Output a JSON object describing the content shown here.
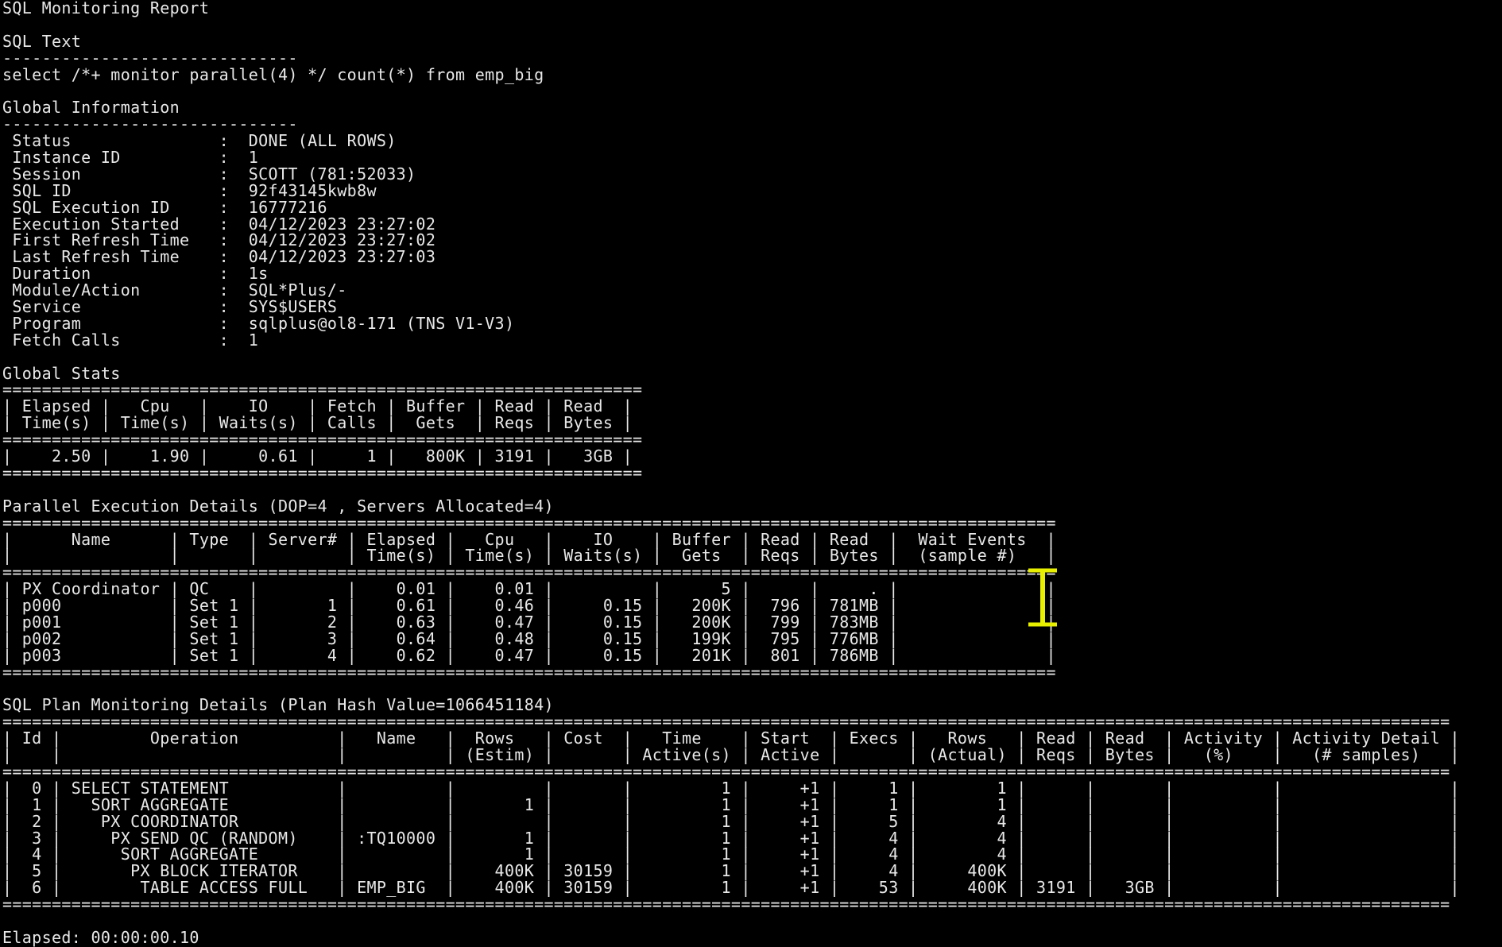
{
  "terminal": {
    "background": "#000000",
    "foreground": "#e8e8e8",
    "cursor_color": "#e8f000",
    "cursor_icon": "text-cursor-ibeam-icon",
    "lines": [
      "SQL Monitoring Report",
      "",
      "SQL Text",
      "------------------------------",
      "select /*+ monitor parallel(4) */ count(*) from emp_big",
      "",
      "Global Information",
      "------------------------------",
      " Status               :  DONE (ALL ROWS)",
      " Instance ID          :  1",
      " Session              :  SCOTT (781:52033)",
      " SQL ID               :  92f43145kwb8w",
      " SQL Execution ID     :  16777216",
      " Execution Started    :  04/12/2023 23:27:02",
      " First Refresh Time   :  04/12/2023 23:27:02",
      " Last Refresh Time    :  04/12/2023 23:27:03",
      " Duration             :  1s",
      " Module/Action        :  SQL*Plus/-",
      " Service              :  SYS$USERS",
      " Program              :  sqlplus@ol8-171 (TNS V1-V3)",
      " Fetch Calls          :  1",
      "",
      "Global Stats",
      "=================================================================",
      "| Elapsed |   Cpu   |    IO    | Fetch | Buffer | Read | Read  |",
      "| Time(s) | Time(s) | Waits(s) | Calls |  Gets  | Reqs | Bytes |",
      "=================================================================",
      "|    2.50 |    1.90 |     0.61 |     1 |   800K | 3191 |   3GB |",
      "=================================================================",
      "",
      "Parallel Execution Details (DOP=4 , Servers Allocated=4)",
      "===========================================================================================================",
      "|      Name      | Type  | Server# | Elapsed |   Cpu   |    IO    | Buffer | Read | Read  |  Wait Events  |",
      "|                |       |         | Time(s) | Time(s) | Waits(s) |  Gets  | Reqs | Bytes |  (sample #)   |",
      "===========================================================================================================",
      "| PX Coordinator | QC    |         |    0.01 |    0.01 |          |      5 |      |     . |               |",
      "| p000           | Set 1 |       1 |    0.61 |    0.46 |     0.15 |   200K |  796 | 781MB |               |",
      "| p001           | Set 1 |       2 |    0.63 |    0.47 |     0.15 |   200K |  799 | 783MB |               |",
      "| p002           | Set 1 |       3 |    0.64 |    0.48 |     0.15 |   199K |  795 | 776MB |               |",
      "| p003           | Set 1 |       4 |    0.62 |    0.47 |     0.15 |   201K |  801 | 786MB |               |",
      "===========================================================================================================",
      "",
      "SQL Plan Monitoring Details (Plan Hash Value=1066451184)",
      "===================================================================================================================================================",
      "| Id |         Operation          |   Name   |  Rows   | Cost  |   Time    | Start  | Execs |   Rows   | Read | Read  | Activity | Activity Detail |",
      "|    |                            |          | (Estim) |       | Active(s) | Active |       | (Actual) | Reqs | Bytes |   (%)    |   (# samples)   |",
      "===================================================================================================================================================",
      "|  0 | SELECT STATEMENT           |          |         |       |         1 |     +1 |     1 |        1 |      |       |          |                 |",
      "|  1 |   SORT AGGREGATE           |          |       1 |       |         1 |     +1 |     1 |        1 |      |       |          |                 |",
      "|  2 |    PX COORDINATOR          |          |         |       |         1 |     +1 |     5 |        4 |      |       |          |                 |",
      "|  3 |     PX SEND QC (RANDOM)    | :TQ10000 |       1 |       |         1 |     +1 |     4 |        4 |      |       |          |                 |",
      "|  4 |      SORT AGGREGATE        |          |       1 |       |         1 |     +1 |     4 |        4 |      |       |          |                 |",
      "|  5 |       PX BLOCK ITERATOR    |          |    400K | 30159 |         1 |     +1 |     4 |     400K |      |       |          |                 |",
      "|  6 |        TABLE ACCESS FULL   | EMP_BIG  |    400K | 30159 |         1 |     +1 |    53 |     400K | 3191 |   3GB |          |                 |",
      "===================================================================================================================================================",
      "",
      "Elapsed: 00:00:00.10"
    ]
  }
}
